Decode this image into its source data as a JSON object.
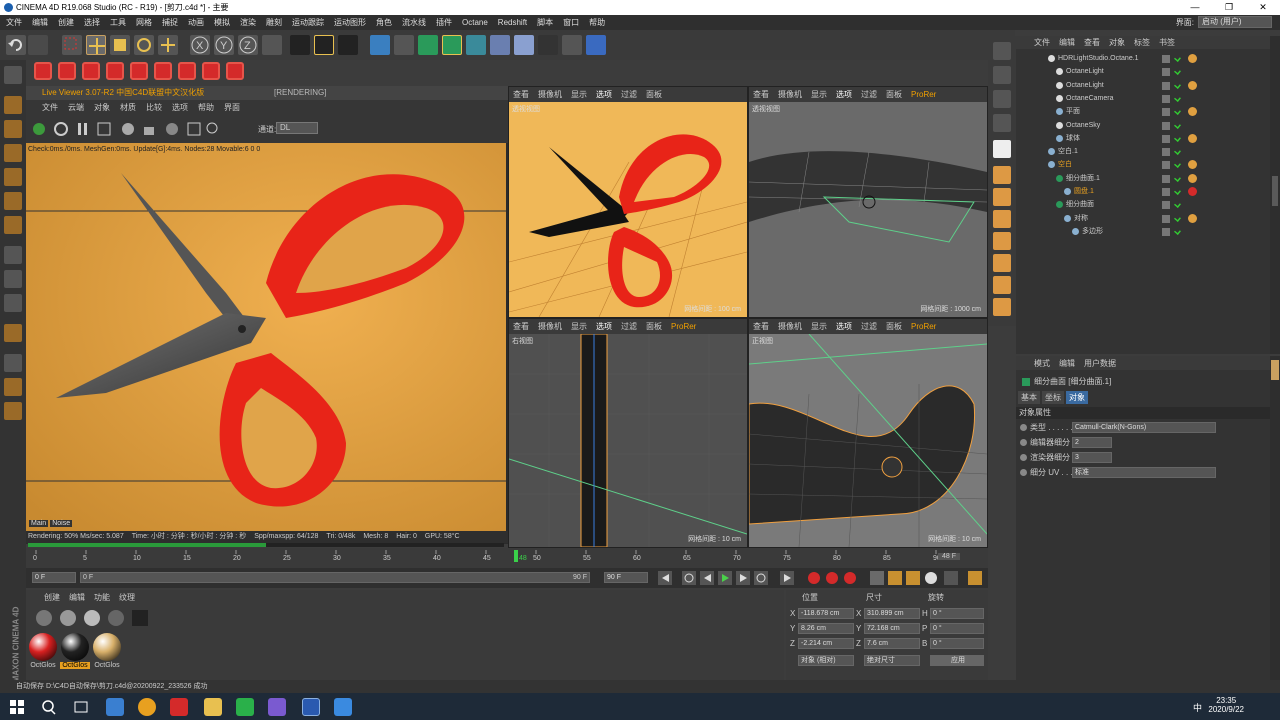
{
  "window": {
    "title": "CINEMA 4D R19.068 Studio (RC - R19) - [剪刀.c4d *] - 主要",
    "controls": [
      "—",
      "❐",
      "✕"
    ]
  },
  "menubar": [
    "文件",
    "编辑",
    "创建",
    "选择",
    "工具",
    "网格",
    "捕捉",
    "动画",
    "模拟",
    "渲染",
    "雕刻",
    "运动跟踪",
    "运动图形",
    "角色",
    "流水线",
    "插件",
    "Octane",
    "Redshift",
    "脚本",
    "窗口",
    "帮助"
  ],
  "layout": {
    "label": "界面:",
    "value": "启动 (用户)"
  },
  "live_viewer": {
    "title": "Live Viewer 3.07-R2 中国C4D联盟中文汉化版",
    "render_tag": "[RENDERING]",
    "menu": [
      "文件",
      "云端",
      "对象",
      "材质",
      "比较",
      "选项",
      "帮助",
      "界面"
    ],
    "channel_label": "通道:",
    "channel_value": "DL",
    "check_line": "Check:0ms./0ms. MeshGen:0ms. Update[G]:4ms. Nodes:28 Movable:6  0 0",
    "tabs": [
      "Main",
      "Noise"
    ],
    "status": [
      "Rendering: 50% Ms/sec: 5.087",
      "Time: 小时 : 分钟 : 秒/小时 : 分钟 : 秒",
      "Spp/maxspp: 64/128",
      "Tri: 0/48k",
      "Mesh: 8",
      "Hair: 0",
      "GPU:  58°C"
    ]
  },
  "viewports": [
    {
      "menu": [
        "查看",
        "摄像机",
        "显示",
        "选项",
        "过滤",
        "面板"
      ],
      "label": "透视视图",
      "grid": "网格间距 : 100 cm"
    },
    {
      "menu": [
        "查看",
        "摄像机",
        "显示",
        "选项",
        "过滤",
        "面板",
        "ProRer"
      ],
      "label": "透视视图",
      "grid": "网格间距 : 1000 cm"
    },
    {
      "menu": [
        "查看",
        "摄像机",
        "显示",
        "选项",
        "过滤",
        "面板",
        "ProRer"
      ],
      "label": "右视图",
      "grid": "网格间距 : 10 cm"
    },
    {
      "menu": [
        "查看",
        "摄像机",
        "显示",
        "选项",
        "过滤",
        "面板",
        "ProRer"
      ],
      "label": "正视图",
      "grid": "网格间距 : 10 cm"
    }
  ],
  "object_manager": {
    "menu": [
      "文件",
      "编辑",
      "查看",
      "对象",
      "标签",
      "书签"
    ],
    "rows": [
      {
        "name": "HDRLightStudio.Octane.1",
        "indent": 0
      },
      {
        "name": "OctaneLight",
        "indent": 1
      },
      {
        "name": "OctaneLight",
        "indent": 1
      },
      {
        "name": "OctaneCamera",
        "indent": 1
      },
      {
        "name": "平面",
        "indent": 1
      },
      {
        "name": "OctaneSky",
        "indent": 1
      },
      {
        "name": "球体",
        "indent": 1
      },
      {
        "name": "空白.1",
        "indent": 0
      },
      {
        "name": "空白",
        "indent": 0
      },
      {
        "name": "细分曲面.1",
        "indent": 1
      },
      {
        "name": "圆盘.1",
        "indent": 2
      },
      {
        "name": "细分曲面",
        "indent": 1
      },
      {
        "name": "对称",
        "indent": 2
      },
      {
        "name": "多边形",
        "indent": 3
      }
    ]
  },
  "attributes": {
    "menu": [
      "模式",
      "编辑",
      "用户数据"
    ],
    "object": "细分曲面 [细分曲面.1]",
    "tabs": [
      "基本",
      "坐标",
      "对象"
    ],
    "section": "对象属性",
    "fields": [
      {
        "label": "类型 . . . . . .",
        "value": "Catmull-Clark(N-Gons)"
      },
      {
        "label": "编辑器细分",
        "value": "2"
      },
      {
        "label": "渲染器细分",
        "value": "3"
      },
      {
        "label": "细分 UV . . . .",
        "value": "标准"
      }
    ]
  },
  "timeline": {
    "ticks": [
      "0",
      "5",
      "10",
      "15",
      "20",
      "25",
      "30",
      "35",
      "40",
      "45",
      "50",
      "55",
      "60",
      "65",
      "70",
      "75",
      "80",
      "85",
      "90"
    ],
    "current": "48",
    "end_label": "48 F"
  },
  "transport": {
    "start": "0 F",
    "current": "0 F",
    "range_end": "90 F",
    "end": "90 F"
  },
  "material_manager": {
    "menu": [
      "创建",
      "编辑",
      "功能",
      "纹理"
    ],
    "materials": [
      {
        "name": "OctGlos",
        "color": "#d82020"
      },
      {
        "name": "OctGlos",
        "color": "#222222"
      },
      {
        "name": "OctGlos",
        "color": "#d8b06a"
      }
    ]
  },
  "coordinates": {
    "headers": [
      "位置",
      "尺寸",
      "旋转"
    ],
    "rows": [
      {
        "axis": "X",
        "pos": "-118.678 cm",
        "size_axis": "X",
        "size": "310.899 cm",
        "rot_axis": "H",
        "rot": "0 °"
      },
      {
        "axis": "Y",
        "pos": "8.26 cm",
        "size_axis": "Y",
        "size": "72.168 cm",
        "rot_axis": "P",
        "rot": "0 °"
      },
      {
        "axis": "Z",
        "pos": "-2.214 cm",
        "size_axis": "Z",
        "size": "7.6 cm",
        "rot_axis": "B",
        "rot": "0 °"
      }
    ],
    "mode": "对象 (相对)",
    "size_mode": "绝对尺寸",
    "apply": "应用"
  },
  "statusbar": "自动保存 D:\\C4D自动保存\\剪刀.c4d@20200922_233526 成功",
  "maxon": "MAXON CINEMA 4D",
  "taskbar": {
    "time": "23:35",
    "date": "2020/9/22",
    "lang": "中"
  }
}
